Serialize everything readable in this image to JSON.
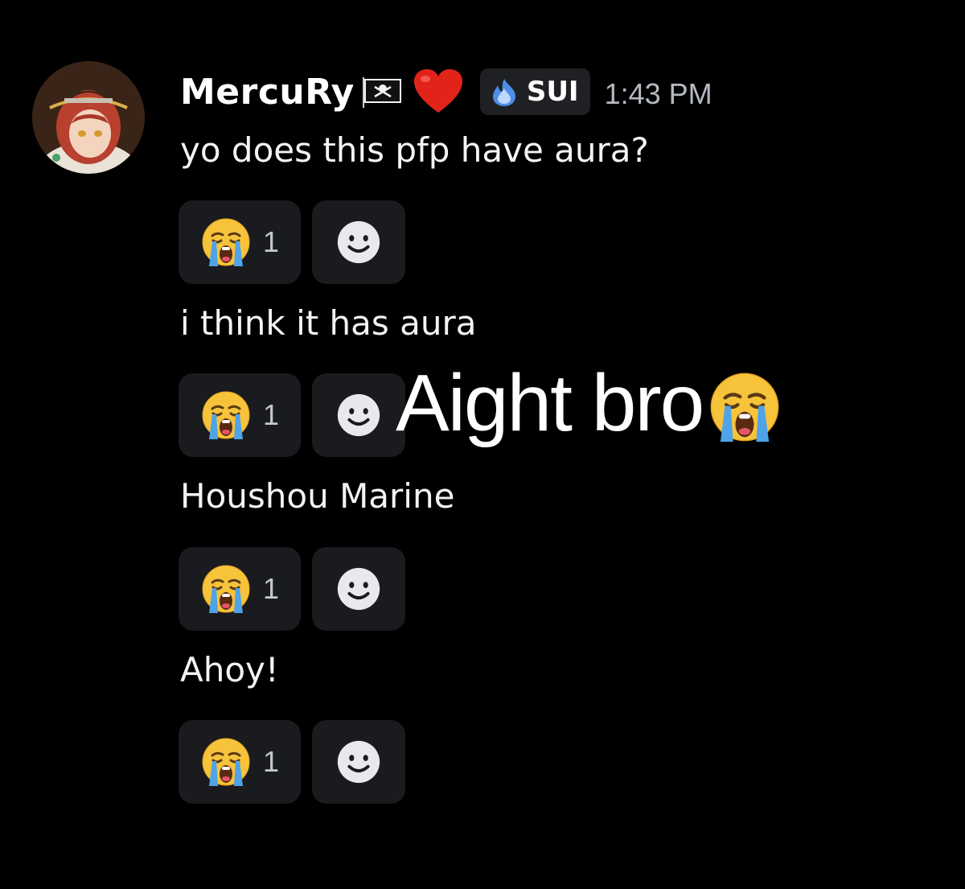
{
  "message": {
    "username": "MercuRy",
    "username_icons": [
      "pirate-flag-icon",
      "red-heart-icon"
    ],
    "server_tag": {
      "icon": "blue-flame-icon",
      "label": "SUI"
    },
    "timestamp": "1:43 PM",
    "avatar": "pirate-anime-girl-avatar"
  },
  "lines": [
    {
      "text": "yo does this pfp have aura?",
      "reaction": {
        "emoji": "loudly-crying-face-icon",
        "count": "1"
      },
      "add_reaction_icon": "add-reaction-smiley-icon"
    },
    {
      "text": "i think it has aura",
      "reaction": {
        "emoji": "loudly-crying-face-icon",
        "count": "1"
      },
      "add_reaction_icon": "add-reaction-smiley-icon"
    },
    {
      "text": "Houshou Marine",
      "reaction": {
        "emoji": "loudly-crying-face-icon",
        "count": "1"
      },
      "add_reaction_icon": "add-reaction-smiley-icon"
    },
    {
      "text": "Ahoy!",
      "reaction": {
        "emoji": "loudly-crying-face-icon",
        "count": "1"
      },
      "add_reaction_icon": "add-reaction-smiley-icon"
    }
  ],
  "overlay": {
    "text": "Aight bro",
    "emoji": "loudly-crying-face-icon"
  },
  "colors": {
    "background": "#000000",
    "text": "#f2f3f5",
    "timestamp": "#b5bac1",
    "reaction_bg": "#1a1b1e",
    "tag_bg": "#1f2023"
  }
}
